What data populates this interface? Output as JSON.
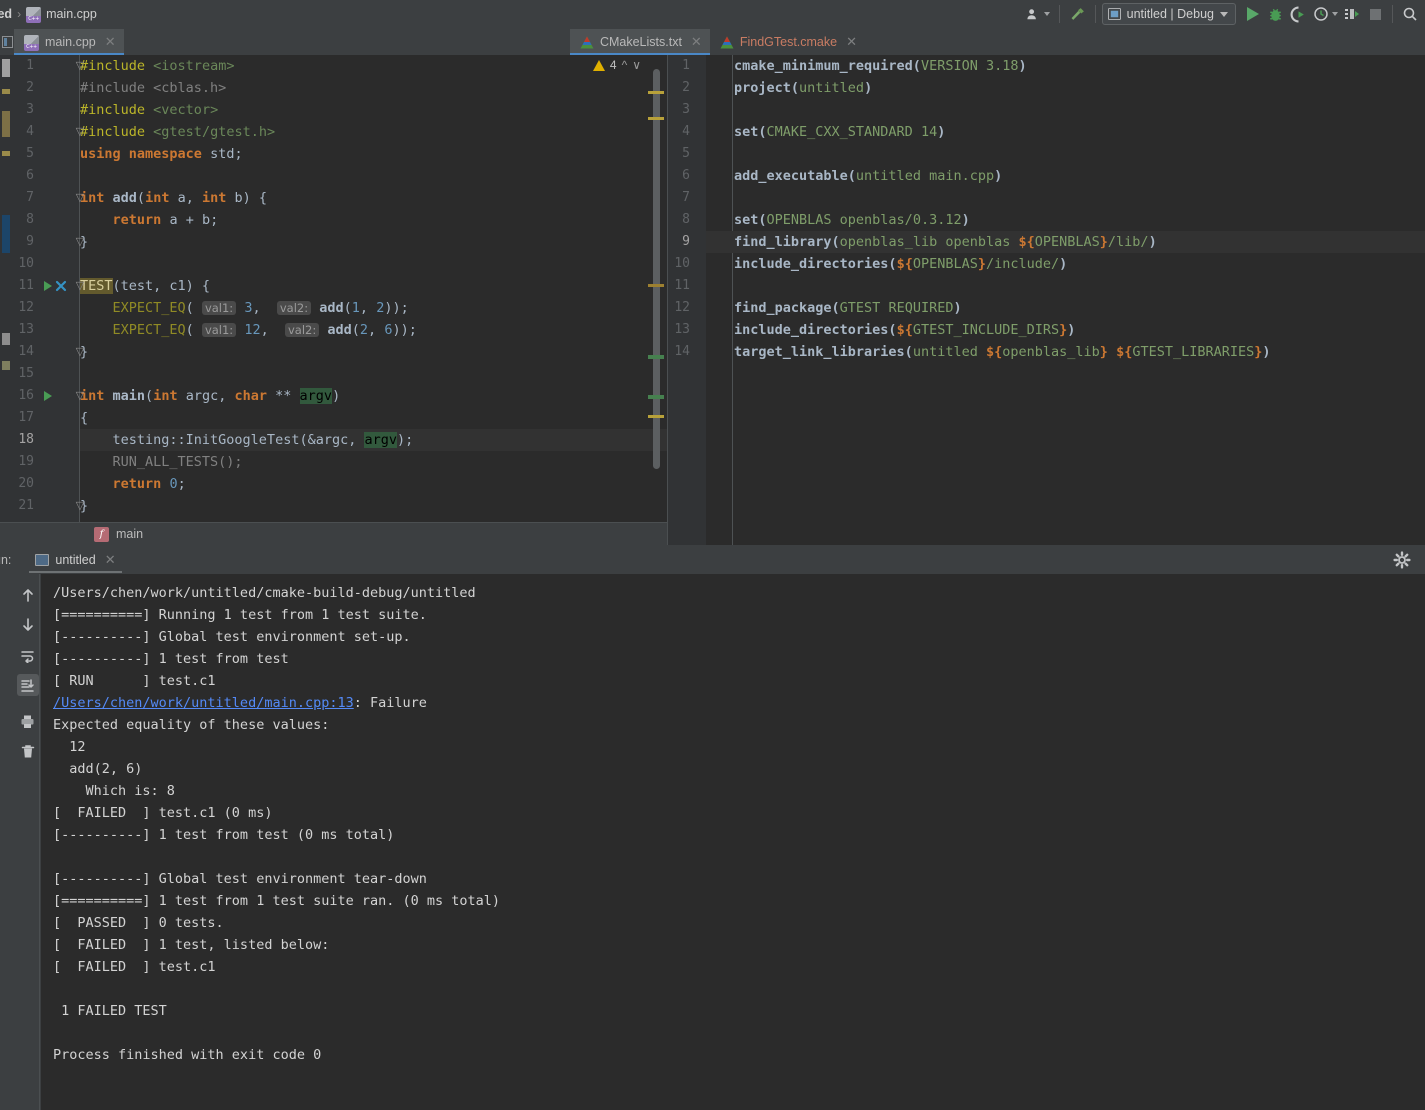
{
  "toolbar": {
    "breadcrumb": {
      "project": "led",
      "separator": "›",
      "file": "main.cpp"
    },
    "run_config": "untitled | Debug",
    "icons": [
      "user-dropdown-icon",
      "build-hammer-icon",
      "run-icon",
      "debug-icon",
      "run-with-coverage-icon",
      "profile-icon",
      "attach-icon",
      "stop-icon",
      "search-icon"
    ]
  },
  "tabs": [
    {
      "label": "main.cpp",
      "icon": "cpp-file-icon",
      "active": true,
      "modified": false
    },
    {
      "label": "CMakeLists.txt",
      "icon": "cmake-file-icon",
      "active": false,
      "modified": false
    },
    {
      "label": "FindGTest.cmake",
      "icon": "cmake-file-icon",
      "active": false,
      "modified": true
    }
  ],
  "editor_left": {
    "file": "main.cpp",
    "current_line": 18,
    "warning_count": "4",
    "breadcrumb": "main",
    "breadcrumb_badge": "f",
    "lines": [
      {
        "n": "1",
        "runicon": false
      },
      {
        "n": "2",
        "runicon": false
      },
      {
        "n": "3",
        "runicon": false
      },
      {
        "n": "4",
        "runicon": false
      },
      {
        "n": "5",
        "runicon": false
      },
      {
        "n": "6",
        "runicon": false
      },
      {
        "n": "7",
        "runicon": false
      },
      {
        "n": "8",
        "runicon": false
      },
      {
        "n": "9",
        "runicon": false
      },
      {
        "n": "10",
        "runicon": false
      },
      {
        "n": "11",
        "runicon": true
      },
      {
        "n": "12",
        "runicon": false
      },
      {
        "n": "13",
        "runicon": false
      },
      {
        "n": "14",
        "runicon": false
      },
      {
        "n": "15",
        "runicon": false
      },
      {
        "n": "16",
        "runicon": true
      },
      {
        "n": "17",
        "runicon": false
      },
      {
        "n": "18",
        "runicon": false
      },
      {
        "n": "19",
        "runicon": false
      },
      {
        "n": "20",
        "runicon": false
      },
      {
        "n": "21",
        "runicon": false
      }
    ],
    "code_text": [
      "#include <iostream>",
      "#include <cblas.h>",
      "#include <vector>",
      "#include <gtest/gtest.h>",
      "using namespace std;",
      "",
      "int add(int a, int b) {",
      "    return a + b;",
      "}",
      "",
      "TEST(test, c1) {",
      "    EXPECT_EQ( val1: 3,   val2: add(1, 2));",
      "    EXPECT_EQ( val1: 12,   val2: add(2, 6));",
      "}",
      "",
      "int main(int argc, char ** argv)",
      "{",
      "    testing::InitGoogleTest(&argc, argv);",
      "    RUN_ALL_TESTS();",
      "    return 0;",
      "}"
    ]
  },
  "editor_right": {
    "file": "CMakeLists.txt",
    "current_line": 9,
    "lines": [
      "1",
      "2",
      "3",
      "4",
      "5",
      "6",
      "7",
      "8",
      "9",
      "10",
      "11",
      "12",
      "13",
      "14"
    ],
    "code_text": [
      "cmake_minimum_required(VERSION 3.18)",
      "project(untitled)",
      "",
      "set(CMAKE_CXX_STANDARD 14)",
      "",
      "add_executable(untitled main.cpp)",
      "",
      "set(OPENBLAS openblas/0.3.12)",
      "find_library(openblas_lib openblas ${OPENBLAS}/lib/)",
      "include_directories(${OPENBLAS}/include/)",
      "",
      "find_package(GTEST REQUIRED)",
      "include_directories(${GTEST_INCLUDE_DIRS})",
      "target_link_libraries(untitled ${openblas_lib} ${GTEST_LIBRARIES})"
    ]
  },
  "run_panel": {
    "label": "un:",
    "tab_label": "untitled",
    "tab_icon": "console-icon",
    "toolbar_icons": [
      "scroll-up-icon",
      "scroll-down-icon",
      "soft-wrap-icon",
      "scroll-to-end-icon",
      "print-icon",
      "clear-all-icon"
    ],
    "settings_icon": "gear-icon",
    "console_lines": [
      {
        "text": "/Users/chen/work/untitled/cmake-build-debug/untitled"
      },
      {
        "text": "[==========] Running 1 test from 1 test suite."
      },
      {
        "text": "[----------] Global test environment set-up."
      },
      {
        "text": "[----------] 1 test from test"
      },
      {
        "text": "[ RUN      ] test.c1"
      },
      {
        "link": "/Users/chen/work/untitled/main.cpp:13",
        "text": ": Failure"
      },
      {
        "text": "Expected equality of these values:"
      },
      {
        "text": "  12"
      },
      {
        "text": "  add(2, 6)"
      },
      {
        "text": "    Which is: 8"
      },
      {
        "text": "[  FAILED  ] test.c1 (0 ms)"
      },
      {
        "text": "[----------] 1 test from test (0 ms total)"
      },
      {
        "text": ""
      },
      {
        "text": "[----------] Global test environment tear-down"
      },
      {
        "text": "[==========] 1 test from 1 test suite ran. (0 ms total)"
      },
      {
        "text": "[  PASSED  ] 0 tests."
      },
      {
        "text": "[  FAILED  ] 1 test, listed below:"
      },
      {
        "text": "[  FAILED  ] test.c1"
      },
      {
        "text": ""
      },
      {
        "text": " 1 FAILED TEST"
      },
      {
        "text": ""
      },
      {
        "text": "Process finished with exit code 0"
      }
    ]
  },
  "colors": {
    "bg_chrome": "#3c3f41",
    "bg_editor": "#2b2b2b",
    "bg_gutter": "#313335",
    "accent_tab": "#4a88c7",
    "keyword": "#cc7832",
    "string": "#6a8759",
    "number": "#6897bb",
    "function": "#ffc66d",
    "preprocessor": "#bbb529",
    "macro": "#908b25",
    "link": "#548af7",
    "run_green": "#499c54",
    "warning": "#e0b000",
    "modified_tab": "#c97c63"
  }
}
